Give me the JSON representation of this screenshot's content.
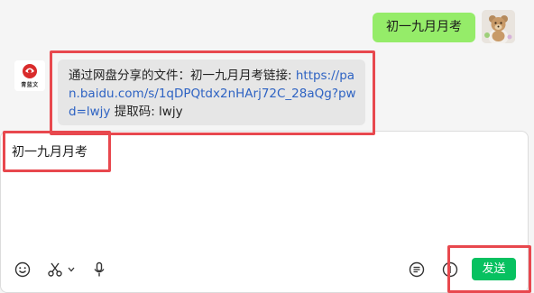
{
  "outgoing_message": {
    "text": "初一九月月考"
  },
  "incoming_message": {
    "prefix": "通过网盘分享的文件：初一九月月考链接: ",
    "link": "https://pan.baidu.com/s/1qDPQtdx2nHArj72C_28aQg?pwd=lwjy",
    "suffix": " 提取码: lwjy"
  },
  "incoming_avatar": {
    "brand_text": "青蓝文"
  },
  "composer": {
    "text": "初一九月月考",
    "send_label": "发送"
  },
  "toolbar": {
    "icons": [
      "emoji-icon",
      "scissors-icon",
      "chevron-down-icon",
      "microphone-icon",
      "chat-history-icon",
      "more-icon"
    ]
  },
  "colors": {
    "outgoing_bubble": "#95ec69",
    "incoming_bubble": "#e6e6e6",
    "link": "#2e63c3",
    "send_button": "#07c160",
    "highlight": "#e8484e"
  }
}
